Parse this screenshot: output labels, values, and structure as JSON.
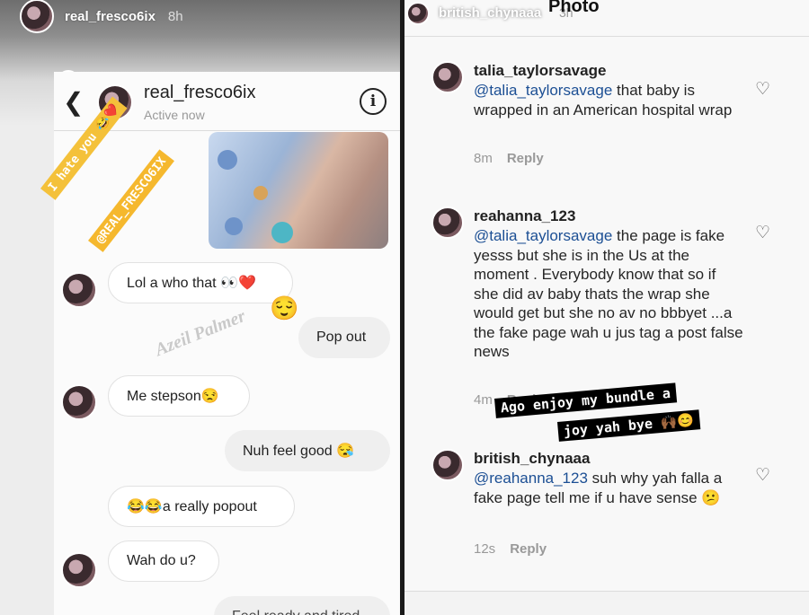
{
  "left_story": {
    "username": "real_fresco6ix",
    "time": "8h",
    "dm": {
      "contact": "real_fresco6ix",
      "status": "Active now",
      "messages": [
        {
          "dir": "in",
          "text": "Lol a who that 👀❤️"
        },
        {
          "dir": "out",
          "text": "Pop out"
        },
        {
          "dir": "in",
          "text": "Me stepson😒"
        },
        {
          "dir": "out",
          "text": "Nuh feel good 😪"
        },
        {
          "dir": "in",
          "text": "😂😂a really popout"
        },
        {
          "dir": "in",
          "text": "Wah do u?"
        },
        {
          "dir": "out",
          "text": "Feel ready and tired"
        }
      ]
    },
    "sticker_text": "I hate you 😂❤️",
    "sticker_handle": "@REAL_FRESCO6IX",
    "emoji_sticker": "😌",
    "watermark": "Azeil Palmer"
  },
  "right_story": {
    "username": "british_chynaaa",
    "time": "3h",
    "title": "Photo",
    "comments": [
      {
        "user": "talia_taylorsavage",
        "mention": "@talia_taylorsavage",
        "text": " that baby is wrapped in an American hospital wrap",
        "time": "8m",
        "reply": "Reply"
      },
      {
        "user": "reahanna_123",
        "mention": "@talia_taylorsavage",
        "text": " the page is fake yesss but she is in the Us at the moment . Everybody know that so if she did av baby thats the wrap she would get but she no av no bbbyet ...a the fake page wah u jus tag a post false news",
        "time": "4m",
        "reply": "Reply"
      },
      {
        "user": "british_chynaaa",
        "mention": "@reahanna_123",
        "text": " suh why yah falla a fake page tell me if u have sense 😕",
        "time": "12s",
        "reply": "Reply"
      }
    ],
    "caption_line1": "Ago enjoy my bundle a",
    "caption_line2": "joy yah bye 🙌🏾😊"
  }
}
